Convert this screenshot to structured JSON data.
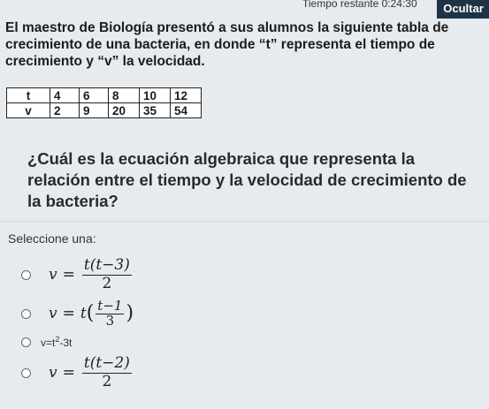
{
  "header": {
    "timer_label": "Tiempo restante",
    "timer_value": "0:24:30",
    "hide_label": "Ocultar"
  },
  "problem": {
    "intro": "El maestro de Biología presentó a sus alumnos la siguiente tabla de crecimiento de una bacteria, en donde “t” representa el tiempo de crecimiento y “v” la velocidad.",
    "table": {
      "row_t": [
        "t",
        "4",
        "6",
        "8",
        "10",
        "12"
      ],
      "row_v": [
        "v",
        "2",
        "9",
        "20",
        "35",
        "54"
      ]
    },
    "question": "¿Cuál es la ecuación algebraica que representa la relación entre el tiempo y la velocidad de crecimiento de la bacteria?"
  },
  "answers": {
    "prompt": "Seleccione una:",
    "options": [
      {
        "lhs": "v",
        "eq": "=",
        "numerator": "t(t−3)",
        "denominator": "2"
      },
      {
        "lhs": "v",
        "eq": "=",
        "coef": "t",
        "numerator": "t−1",
        "denominator": "3"
      },
      {
        "text_base": "v=t",
        "text_exp": "2",
        "text_tail": "-3t"
      },
      {
        "lhs": "v",
        "eq": "=",
        "numerator": "t(t−2)",
        "denominator": "2"
      }
    ]
  }
}
